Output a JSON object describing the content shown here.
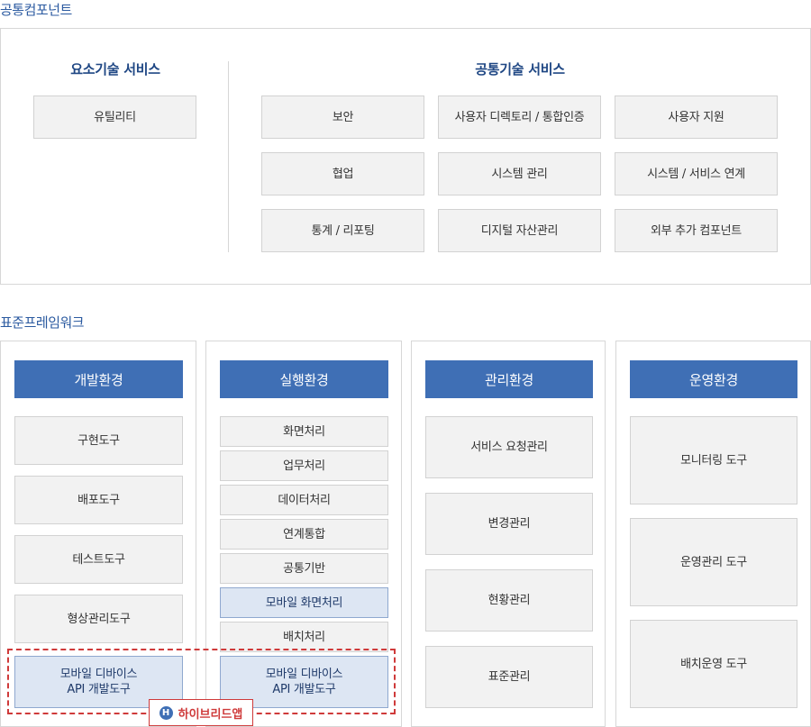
{
  "common": {
    "title": "공통컴포넌트",
    "element_tech": {
      "title": "요소기술 서비스",
      "items": [
        "유틸리티"
      ]
    },
    "common_tech": {
      "title": "공통기술 서비스",
      "items": [
        "보안",
        "사용자 디렉토리 / 통합인증",
        "사용자 지원",
        "협업",
        "시스템 관리",
        "시스템 / 서비스 연계",
        "통계 / 리포팅",
        "디지털 자산관리",
        "외부 추가 컴포넌트"
      ]
    }
  },
  "framework": {
    "title": "표준프레임워크",
    "dev": {
      "title": "개발환경",
      "items": [
        "구현도구",
        "배포도구",
        "테스트도구",
        "형상관리도구"
      ],
      "mobile": [
        "모바일 디바이스",
        "API 개발도구"
      ]
    },
    "run": {
      "title": "실행환경",
      "items": [
        "화면처리",
        "업무처리",
        "데이터처리",
        "연계통합",
        "공통기반",
        "모바일 화면처리",
        "배치처리"
      ],
      "mobile": [
        "모바일 디바이스",
        "API 개발도구"
      ]
    },
    "mgmt": {
      "title": "관리환경",
      "items": [
        "서비스 요청관리",
        "변경관리",
        "현황관리",
        "표준관리"
      ]
    },
    "ops": {
      "title": "운영환경",
      "items": [
        "모니터링 도구",
        "운영관리 도구",
        "배치운영 도구"
      ]
    },
    "hybrid": {
      "icon_letter": "H",
      "label": "하이브리드앱"
    }
  }
}
